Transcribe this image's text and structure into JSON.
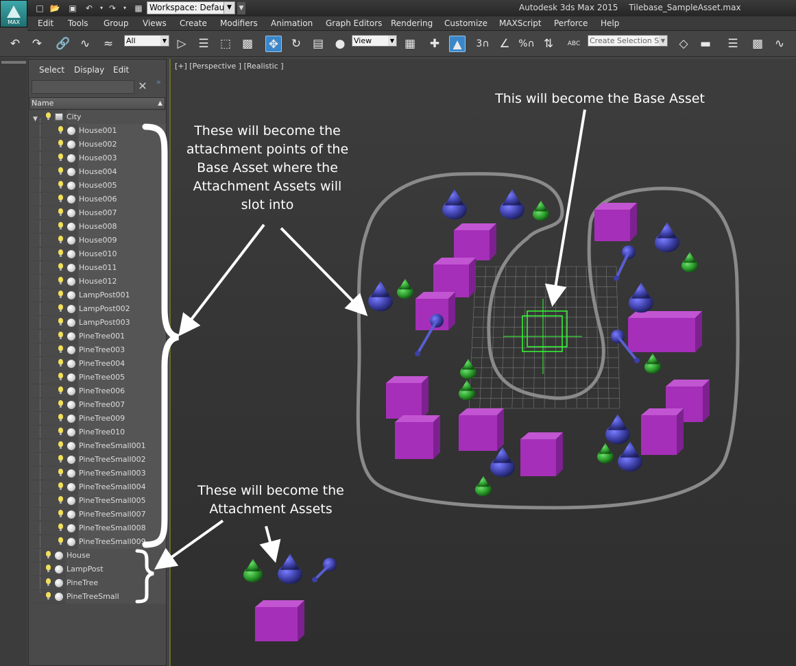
{
  "titlebar": {
    "logo_label": "MAX",
    "workspace_label": "Workspace: Default",
    "app_name": "Autodesk 3ds Max  2015",
    "file_name": "Tilebase_SampleAsset.max"
  },
  "menubar": {
    "items": [
      "Edit",
      "Tools",
      "Group",
      "Views",
      "Create",
      "Modifiers",
      "Animation",
      "Graph Editors",
      "Rendering",
      "Customize",
      "MAXScript",
      "Perforce",
      "Help"
    ]
  },
  "toolbar": {
    "selection_filter": "All",
    "reference_coord": "View",
    "snap_3": "3",
    "snap_percent": "%",
    "named_selection_placeholder": "Create Selection Se",
    "abc_label": "ABC"
  },
  "explorer": {
    "tabs": [
      "Select",
      "Display",
      "Edit"
    ],
    "column_name": "Name",
    "root": "City",
    "children": [
      "House001",
      "House002",
      "House003",
      "House004",
      "House005",
      "House006",
      "House007",
      "House008",
      "House009",
      "House010",
      "House011",
      "House012",
      "LampPost001",
      "LampPost002",
      "LampPost003",
      "PineTree001",
      "PineTree003",
      "PineTree004",
      "PineTree005",
      "PineTree006",
      "PineTree007",
      "PineTree009",
      "PineTree010",
      "PineTreeSmall001",
      "PineTreeSmall002",
      "PineTreeSmall003",
      "PineTreeSmall004",
      "PineTreeSmall005",
      "PineTreeSmall007",
      "PineTreeSmall008",
      "PineTreeSmall009"
    ],
    "top_level": [
      "House",
      "LampPost",
      "PineTree",
      "PineTreeSmall"
    ]
  },
  "viewport": {
    "label": "[+] [Perspective ] [Realistic ]"
  },
  "annotations": {
    "attachment_points": "These will become the attachment points of the Base Asset where the Attachment Assets will slot into",
    "base_asset": "This will become the Base Asset",
    "attachment_assets": "These will become the Attachment Assets"
  },
  "colors": {
    "house": "#a52fb8",
    "house_top": "#c255d2",
    "tree_blue": "#3c3fa6",
    "tree_green": "#2a9a2a",
    "helper_green": "#33ff33",
    "outline": "#8a8a8a"
  }
}
